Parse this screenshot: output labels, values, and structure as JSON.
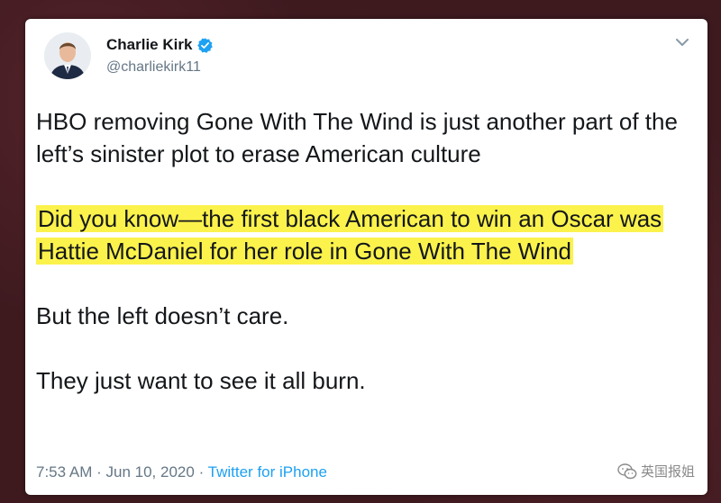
{
  "tweet": {
    "author_name": "Charlie Kirk",
    "handle": "@charliekirk11",
    "paragraphs": [
      "HBO removing Gone With The Wind is just another part of the left’s sinister plot to erase American culture",
      "Did you know—the first black American to win an Oscar was Hattie McDaniel for her role in Gone With The Wind",
      "But the left doesn’t care.",
      "They just want to see it all burn."
    ],
    "time": "7:53 AM",
    "separator": "·",
    "date": "Jun 10, 2020",
    "source": "Twitter for iPhone"
  },
  "watermark": {
    "text": "英国报姐"
  },
  "colors": {
    "background": "#3e1a1f",
    "card": "#ffffff",
    "highlight": "#fbf24c",
    "link_blue": "#1da1f2",
    "muted_text": "#657786",
    "verified_badge": "#1da1f2"
  },
  "icons": [
    "verified-badge-icon",
    "chevron-down-icon",
    "wechat-icon"
  ]
}
